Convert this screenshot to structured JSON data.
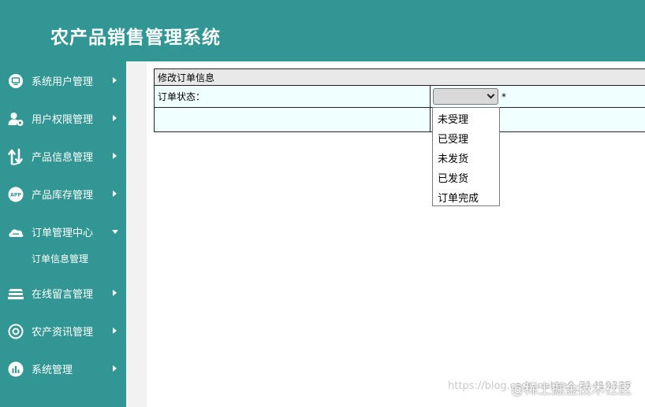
{
  "header": {
    "title": "农产品销售管理系统"
  },
  "sidebar": {
    "items": [
      {
        "label": "系统用户管理",
        "icon": "monitor-icon"
      },
      {
        "label": "用户权限管理",
        "icon": "user-gear-icon"
      },
      {
        "label": "产品信息管理",
        "icon": "transfer-arrows-icon"
      },
      {
        "label": "产品库存管理",
        "icon": "app-badge-icon"
      },
      {
        "label": "订单管理中心",
        "icon": "cloud-icon",
        "expanded": true,
        "subitems": [
          {
            "label": "订单信息管理"
          }
        ]
      },
      {
        "label": "在线留言管理",
        "icon": "stack-icon"
      },
      {
        "label": "农产资讯管理",
        "icon": "settings-circle-icon"
      },
      {
        "label": "系统管理",
        "icon": "bar-chart-icon"
      }
    ]
  },
  "form": {
    "title": "修改订单信息",
    "status_label": "订单状态：",
    "status_value": "",
    "required_mark": "*"
  },
  "dropdown": {
    "options": [
      "未受理",
      "已受理",
      "未发货",
      "已发货",
      "订单完成"
    ]
  },
  "watermark": {
    "text": "https://blog.csdn.net/m0_71419325",
    "brand": "@稀土掘金技术社区"
  },
  "colors": {
    "primary": "#329794",
    "cell_background": "#f0ffff",
    "title_row_background": "#e9e9e9"
  }
}
